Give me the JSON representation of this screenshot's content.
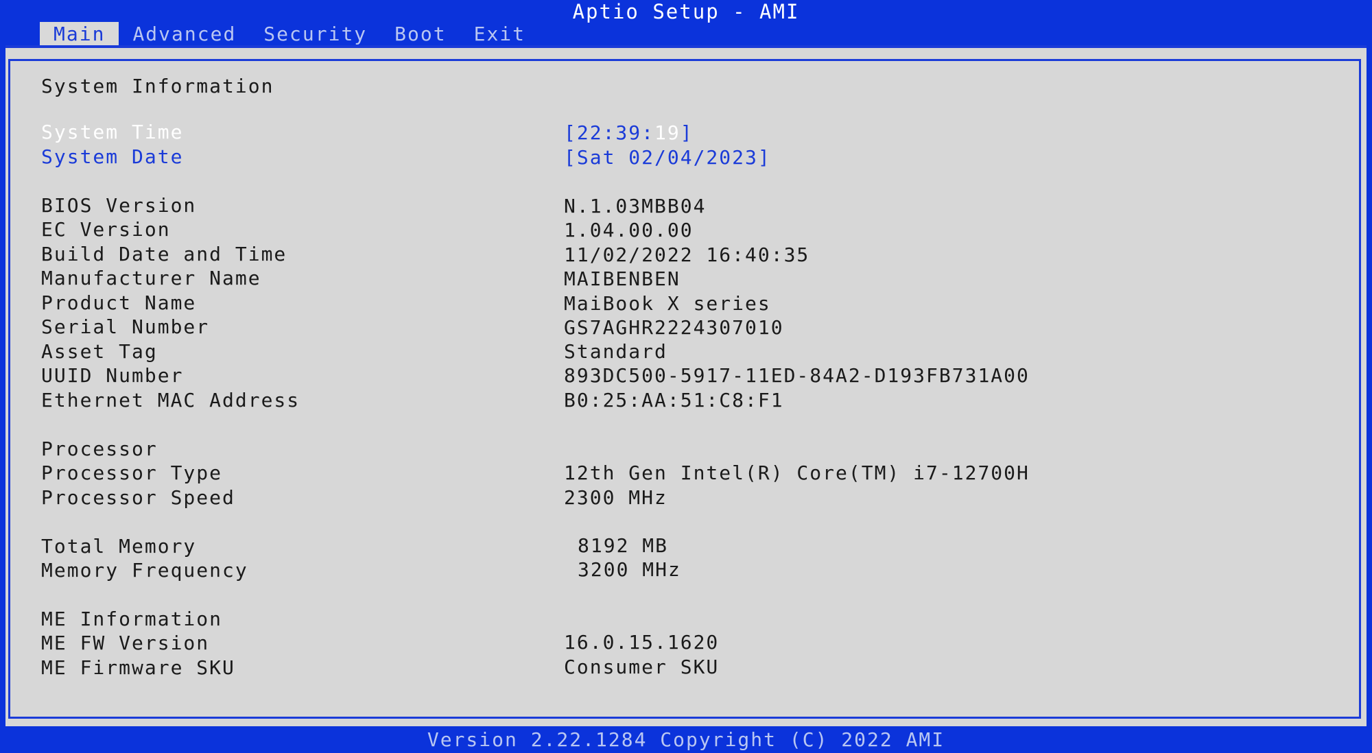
{
  "window": {
    "title": "Aptio Setup - AMI"
  },
  "tabs": [
    {
      "label": "Main"
    },
    {
      "label": "Advanced"
    },
    {
      "label": "Security"
    },
    {
      "label": "Boot"
    },
    {
      "label": "Exit"
    }
  ],
  "main": {
    "section_system": "System Information",
    "system_time": {
      "label": "System Time",
      "value_prefix": "[22:39:",
      "value_seconds": "19",
      "value_suffix": "]"
    },
    "system_date": {
      "label": "System Date",
      "value": "[Sat 02/04/2023]"
    },
    "bios_version": {
      "label": "BIOS Version",
      "value": "N.1.03MBB04"
    },
    "ec_version": {
      "label": "EC Version",
      "value": "1.04.00.00"
    },
    "build_date": {
      "label": "Build Date and Time",
      "value": "11/02/2022 16:40:35"
    },
    "manufacturer": {
      "label": "Manufacturer Name",
      "value": "MAIBENBEN"
    },
    "product": {
      "label": "Product Name",
      "value": "MaiBook X series"
    },
    "serial": {
      "label": "Serial Number",
      "value": "GS7AGHR2224307010"
    },
    "asset_tag": {
      "label": "Asset Tag",
      "value": "Standard"
    },
    "uuid": {
      "label": "UUID Number",
      "value": "893DC500-5917-11ED-84A2-D193FB731A00"
    },
    "mac": {
      "label": "Ethernet MAC Address",
      "value": "B0:25:AA:51:C8:F1"
    },
    "section_processor": "Processor",
    "processor_type": {
      "label": "Processor Type",
      "value": "12th Gen Intel(R) Core(TM) i7-12700H"
    },
    "processor_speed": {
      "label": "Processor Speed",
      "value": "2300 MHz"
    },
    "total_memory": {
      "label": "Total Memory",
      "value": "8192 MB"
    },
    "memory_frequency": {
      "label": "Memory Frequency",
      "value": "3200 MHz"
    },
    "section_me": "ME Information",
    "me_fw_version": {
      "label": "ME FW Version",
      "value": "16.0.15.1620"
    },
    "me_firmware_sku": {
      "label": "ME Firmware SKU",
      "value": "Consumer SKU"
    }
  },
  "footer": {
    "text": "Version 2.22.1284 Copyright (C) 2022 AMI"
  },
  "colors": {
    "background_blue": "#0b33db",
    "panel_gray": "#d7d7d7",
    "link_blue": "#1a3bd8",
    "text_dark": "#1a1a1a",
    "highlight_white": "#ffffff"
  }
}
